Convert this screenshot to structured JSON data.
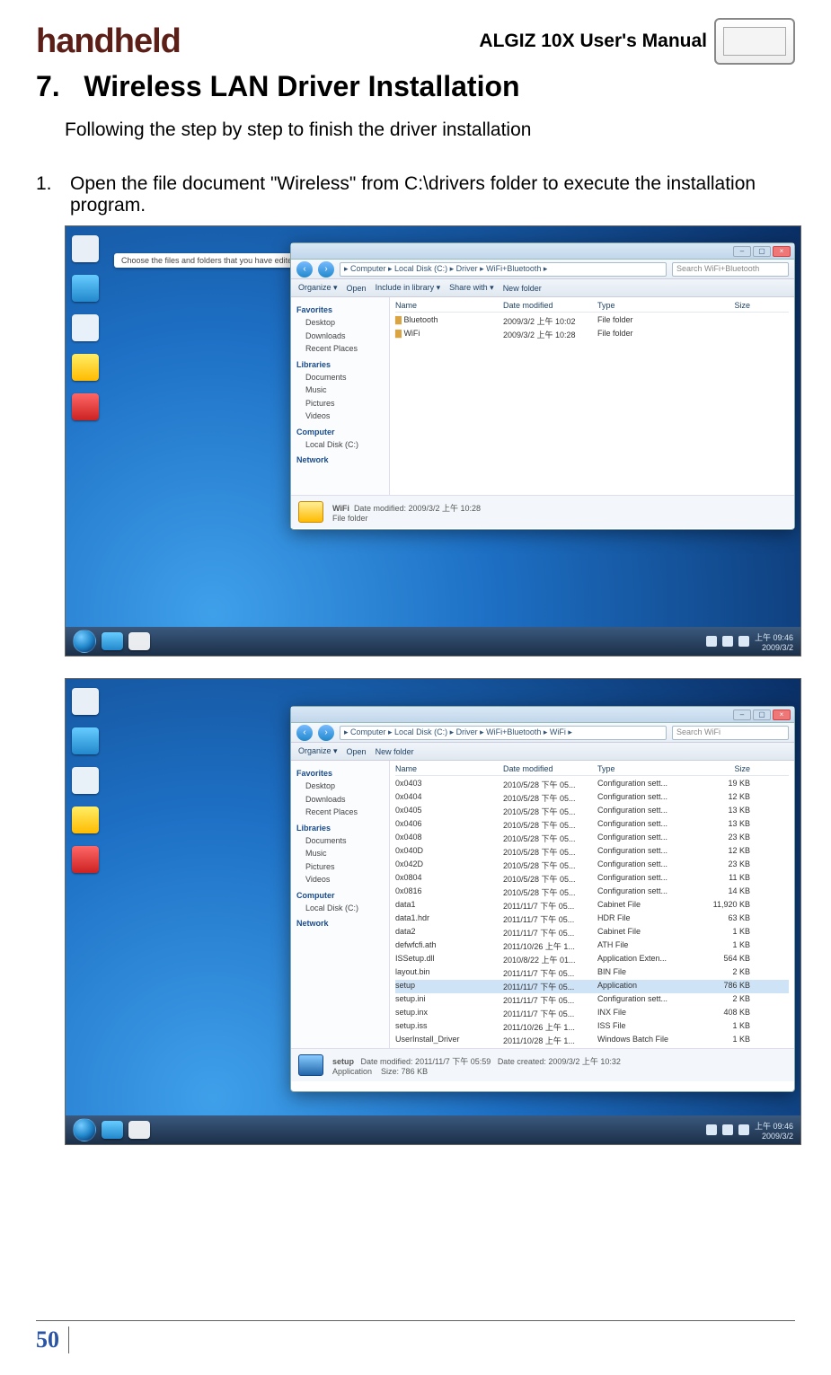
{
  "header": {
    "logo_text": "handheld",
    "doc_title": "ALGIZ 10X User's Manual"
  },
  "section": {
    "number": "7.",
    "title": "Wireless LAN Driver Installation",
    "intro": "Following the step by step to finish the driver installation",
    "step1_num": "1.",
    "step1_text": "Open the file document \"Wireless\" from C:\\drivers folder to execute the installation program."
  },
  "screenshot1": {
    "search_pill": "Choose the files and folders that you have edited",
    "address": "▸ Computer ▸ Local Disk (C:) ▸ Driver ▸ WiFi+Bluetooth ▸",
    "search_placeholder": "Search WiFi+Bluetooth",
    "toolbar": [
      "Organize ▾",
      "Open",
      "Include in library ▾",
      "Share with ▾",
      "New folder"
    ],
    "side": {
      "favorites": "Favorites",
      "desktop": "Desktop",
      "downloads": "Downloads",
      "recent": "Recent Places",
      "libraries": "Libraries",
      "documents": "Documents",
      "music": "Music",
      "pictures": "Pictures",
      "videos": "Videos",
      "computer": "Computer",
      "localdisk": "Local Disk (C:)",
      "network": "Network"
    },
    "cols": {
      "name": "Name",
      "date": "Date modified",
      "type": "Type",
      "size": "Size"
    },
    "rows": [
      {
        "name": "Bluetooth",
        "date": "2009/3/2 上午 10:02",
        "type": "File folder",
        "size": ""
      },
      {
        "name": "WiFi",
        "date": "2009/3/2 上午 10:28",
        "type": "File folder",
        "size": ""
      }
    ],
    "detail_name": "WiFi",
    "detail_line": "Date modified: 2009/3/2 上午 10:28",
    "detail_type": "File folder",
    "clock": "上午 09:46\n2009/3/2"
  },
  "screenshot2": {
    "address": "▸ Computer ▸ Local Disk (C:) ▸ Driver ▸ WiFi+Bluetooth ▸ WiFi ▸",
    "search_placeholder": "Search WiFi",
    "toolbar": [
      "Organize ▾",
      "Open",
      "New folder"
    ],
    "cols": {
      "name": "Name",
      "date": "Date modified",
      "type": "Type",
      "size": "Size"
    },
    "rows": [
      {
        "name": "0x0403",
        "date": "2010/5/28 下午 05...",
        "type": "Configuration sett...",
        "size": "19 KB"
      },
      {
        "name": "0x0404",
        "date": "2010/5/28 下午 05...",
        "type": "Configuration sett...",
        "size": "12 KB"
      },
      {
        "name": "0x0405",
        "date": "2010/5/28 下午 05...",
        "type": "Configuration sett...",
        "size": "13 KB"
      },
      {
        "name": "0x0406",
        "date": "2010/5/28 下午 05...",
        "type": "Configuration sett...",
        "size": "13 KB"
      },
      {
        "name": "0x0408",
        "date": "2010/5/28 下午 05...",
        "type": "Configuration sett...",
        "size": "23 KB"
      },
      {
        "name": "0x040D",
        "date": "2010/5/28 下午 05...",
        "type": "Configuration sett...",
        "size": "12 KB"
      },
      {
        "name": "0x042D",
        "date": "2010/5/28 下午 05...",
        "type": "Configuration sett...",
        "size": "23 KB"
      },
      {
        "name": "0x0804",
        "date": "2010/5/28 下午 05...",
        "type": "Configuration sett...",
        "size": "11 KB"
      },
      {
        "name": "0x0816",
        "date": "2010/5/28 下午 05...",
        "type": "Configuration sett...",
        "size": "14 KB"
      },
      {
        "name": "data1",
        "date": "2011/11/7 下午 05...",
        "type": "Cabinet File",
        "size": "11,920 KB"
      },
      {
        "name": "data1.hdr",
        "date": "2011/11/7 下午 05...",
        "type": "HDR File",
        "size": "63 KB"
      },
      {
        "name": "data2",
        "date": "2011/11/7 下午 05...",
        "type": "Cabinet File",
        "size": "1 KB"
      },
      {
        "name": "defwfcfi.ath",
        "date": "2011/10/26 上午 1...",
        "type": "ATH File",
        "size": "1 KB"
      },
      {
        "name": "ISSetup.dll",
        "date": "2010/8/22 上午 01...",
        "type": "Application Exten...",
        "size": "564 KB"
      },
      {
        "name": "layout.bin",
        "date": "2011/11/7 下午 05...",
        "type": "BIN File",
        "size": "2 KB"
      },
      {
        "name": "setup",
        "date": "2011/11/7 下午 05...",
        "type": "Application",
        "size": "786 KB",
        "sel": true
      },
      {
        "name": "setup.ini",
        "date": "2011/11/7 下午 05...",
        "type": "Configuration sett...",
        "size": "2 KB"
      },
      {
        "name": "setup.inx",
        "date": "2011/11/7 下午 05...",
        "type": "INX File",
        "size": "408 KB"
      },
      {
        "name": "setup.iss",
        "date": "2011/10/26 上午 1...",
        "type": "ISS File",
        "size": "1 KB"
      },
      {
        "name": "UserInstall_Driver",
        "date": "2011/10/28 上午 1...",
        "type": "Windows Batch File",
        "size": "1 KB"
      }
    ],
    "detail_name": "setup",
    "detail_line1": "Date modified: 2011/11/7 下午 05:59",
    "detail_line2": "Size: 786 KB",
    "detail_line3": "Date created: 2009/3/2 上午 10:32",
    "detail_type": "Application",
    "clock": "上午 09:46\n2009/3/2"
  },
  "footer": {
    "page": "50"
  }
}
